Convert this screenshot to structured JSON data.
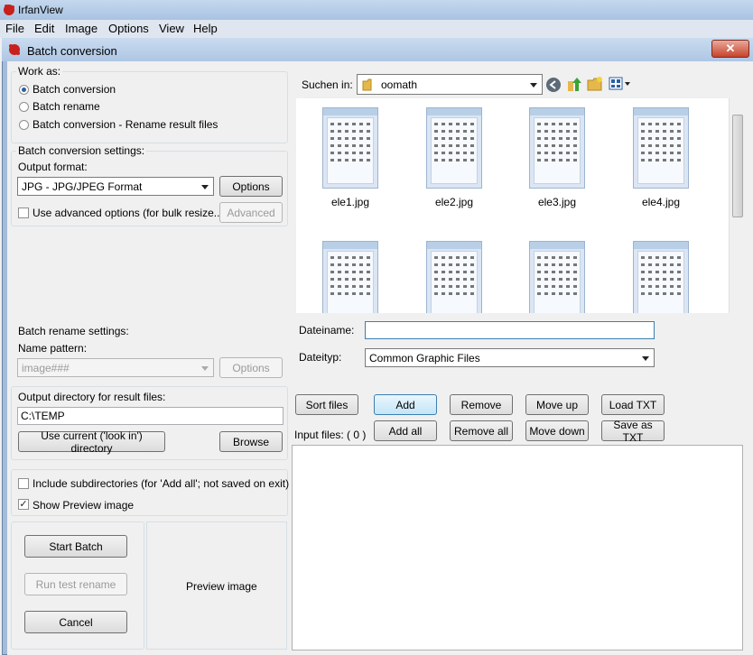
{
  "app": {
    "title": "IrfanView",
    "menu": [
      "File",
      "Edit",
      "Image",
      "Options",
      "View",
      "Help"
    ]
  },
  "dialog": {
    "title": "Batch conversion",
    "close_glyph": "✕"
  },
  "work_as": {
    "label": "Work as:",
    "options": [
      "Batch conversion",
      "Batch rename",
      "Batch conversion - Rename result files"
    ],
    "selected": "Batch conversion"
  },
  "conversion": {
    "label": "Batch conversion settings:",
    "output_format_label": "Output format:",
    "output_format_value": "JPG - JPG/JPEG Format",
    "options_button": "Options",
    "advanced_check_label": "Use advanced options (for bulk resize...)",
    "advanced_button": "Advanced"
  },
  "rename": {
    "label": "Batch rename settings:",
    "pattern_label": "Name pattern:",
    "pattern_value": "image###",
    "options_button": "Options"
  },
  "output_dir": {
    "label": "Output directory for result files:",
    "value": "C:\\TEMP",
    "use_current_button": "Use current ('look in') directory",
    "browse_button": "Browse"
  },
  "checks": {
    "subdirs_label": "Include subdirectories (for 'Add all'; not saved on exit)",
    "subdirs_checked": false,
    "preview_label": "Show Preview image",
    "preview_checked": true
  },
  "actions": {
    "start": "Start Batch",
    "test_rename": "Run test rename",
    "cancel": "Cancel"
  },
  "preview": {
    "text": "Preview image"
  },
  "browser": {
    "look_in_label": "Suchen in:",
    "folder": "oomath",
    "files": [
      "ele1.jpg",
      "ele2.jpg",
      "ele3.jpg",
      "ele4.jpg"
    ],
    "filename_label": "Dateiname:",
    "filename_value": "",
    "filetype_label": "Dateityp:",
    "filetype_value": "Common Graphic Files"
  },
  "list_buttons": {
    "sort": "Sort files",
    "add": "Add",
    "remove": "Remove",
    "move_up": "Move up",
    "load_txt": "Load TXT",
    "add_all": "Add all",
    "remove_all": "Remove all",
    "move_down": "Move down",
    "save_txt": "Save as TXT"
  },
  "input_files": {
    "label": "Input files: ( 0 )"
  },
  "colors": {
    "accent": "#2b5f9e",
    "title_bar": "#aec6e4"
  }
}
